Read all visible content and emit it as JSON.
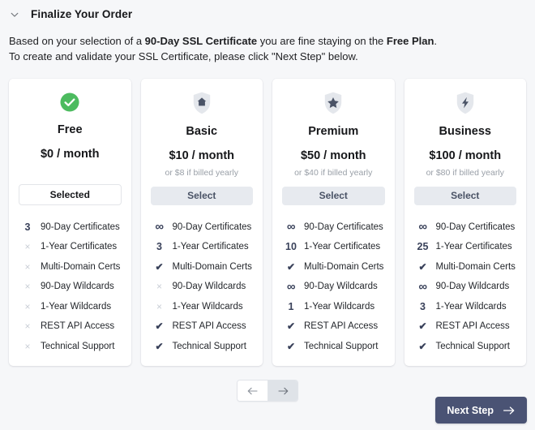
{
  "header": {
    "title": "Finalize Your Order",
    "collapse_icon": "chevron-down-icon"
  },
  "description": {
    "line1_part1": "Based on your selection of a ",
    "line1_bold1": "90-Day SSL Certificate",
    "line1_part2": " you are fine staying on the ",
    "line1_bold2": "Free Plan",
    "line1_part3": ".",
    "line2": "To create and validate your SSL Certificate, please click \"Next Step\" below."
  },
  "feature_names": [
    "90-Day Certificates",
    "1-Year Certificates",
    "Multi-Domain Certs",
    "90-Day Wildcards",
    "1-Year Wildcards",
    "REST API Access",
    "Technical Support"
  ],
  "plans": [
    {
      "name": "Free",
      "icon": "green-check-circle-icon",
      "price": "$0 / month",
      "yearly_note": "",
      "button_label": "Selected",
      "button_state": "selected",
      "features": [
        {
          "marker": "3",
          "type": "num",
          "label": "90-Day Certificates"
        },
        {
          "marker": "×",
          "type": "cross",
          "label": "1-Year Certificates"
        },
        {
          "marker": "×",
          "type": "cross",
          "label": "Multi-Domain Certs"
        },
        {
          "marker": "×",
          "type": "cross",
          "label": "90-Day Wildcards"
        },
        {
          "marker": "×",
          "type": "cross",
          "label": "1-Year Wildcards"
        },
        {
          "marker": "×",
          "type": "cross",
          "label": "REST API Access"
        },
        {
          "marker": "×",
          "type": "cross",
          "label": "Technical Support"
        }
      ]
    },
    {
      "name": "Basic",
      "icon": "shield-home-icon",
      "price": "$10 / month",
      "yearly_note": "or $8 if billed yearly",
      "button_label": "Select",
      "button_state": "select",
      "features": [
        {
          "marker": "∞",
          "type": "inf",
          "label": "90-Day Certificates"
        },
        {
          "marker": "3",
          "type": "num",
          "label": "1-Year Certificates"
        },
        {
          "marker": "✔",
          "type": "check",
          "label": "Multi-Domain Certs"
        },
        {
          "marker": "×",
          "type": "cross",
          "label": "90-Day Wildcards"
        },
        {
          "marker": "×",
          "type": "cross",
          "label": "1-Year Wildcards"
        },
        {
          "marker": "✔",
          "type": "check",
          "label": "REST API Access"
        },
        {
          "marker": "✔",
          "type": "check",
          "label": "Technical Support"
        }
      ]
    },
    {
      "name": "Premium",
      "icon": "shield-star-icon",
      "price": "$50 / month",
      "yearly_note": "or $40 if billed yearly",
      "button_label": "Select",
      "button_state": "select",
      "features": [
        {
          "marker": "∞",
          "type": "inf",
          "label": "90-Day Certificates"
        },
        {
          "marker": "10",
          "type": "num",
          "label": "1-Year Certificates"
        },
        {
          "marker": "✔",
          "type": "check",
          "label": "Multi-Domain Certs"
        },
        {
          "marker": "∞",
          "type": "inf",
          "label": "90-Day Wildcards"
        },
        {
          "marker": "1",
          "type": "num",
          "label": "1-Year Wildcards"
        },
        {
          "marker": "✔",
          "type": "check",
          "label": "REST API Access"
        },
        {
          "marker": "✔",
          "type": "check",
          "label": "Technical Support"
        }
      ]
    },
    {
      "name": "Business",
      "icon": "shield-bolt-icon",
      "price": "$100 / month",
      "yearly_note": "or $80 if billed yearly",
      "button_label": "Select",
      "button_state": "select",
      "features": [
        {
          "marker": "∞",
          "type": "inf",
          "label": "90-Day Certificates"
        },
        {
          "marker": "25",
          "type": "num",
          "label": "1-Year Certificates"
        },
        {
          "marker": "✔",
          "type": "check",
          "label": "Multi-Domain Certs"
        },
        {
          "marker": "∞",
          "type": "inf",
          "label": "90-Day Wildcards"
        },
        {
          "marker": "3",
          "type": "num",
          "label": "1-Year Wildcards"
        },
        {
          "marker": "✔",
          "type": "check",
          "label": "REST API Access"
        },
        {
          "marker": "✔",
          "type": "check",
          "label": "Technical Support"
        }
      ]
    }
  ],
  "pager": {
    "prev_icon": "arrow-left-icon",
    "next_icon": "arrow-right-icon",
    "prev_glyph": "←",
    "next_glyph": "→",
    "active": "next"
  },
  "next_step": {
    "label": "Next Step",
    "arrow": "→",
    "icon": "arrow-right-icon"
  },
  "colors": {
    "page_background": "#f6f7f9",
    "card_background": "#ffffff",
    "accent_green": "#4cbb5f",
    "shield_grey": "#e4e7ec",
    "shield_glyph": "#4a5366",
    "select_button": "#e7eaef",
    "next_button": "#4a5374",
    "marker_dark": "#39415a",
    "marker_muted": "#c9ced6"
  }
}
